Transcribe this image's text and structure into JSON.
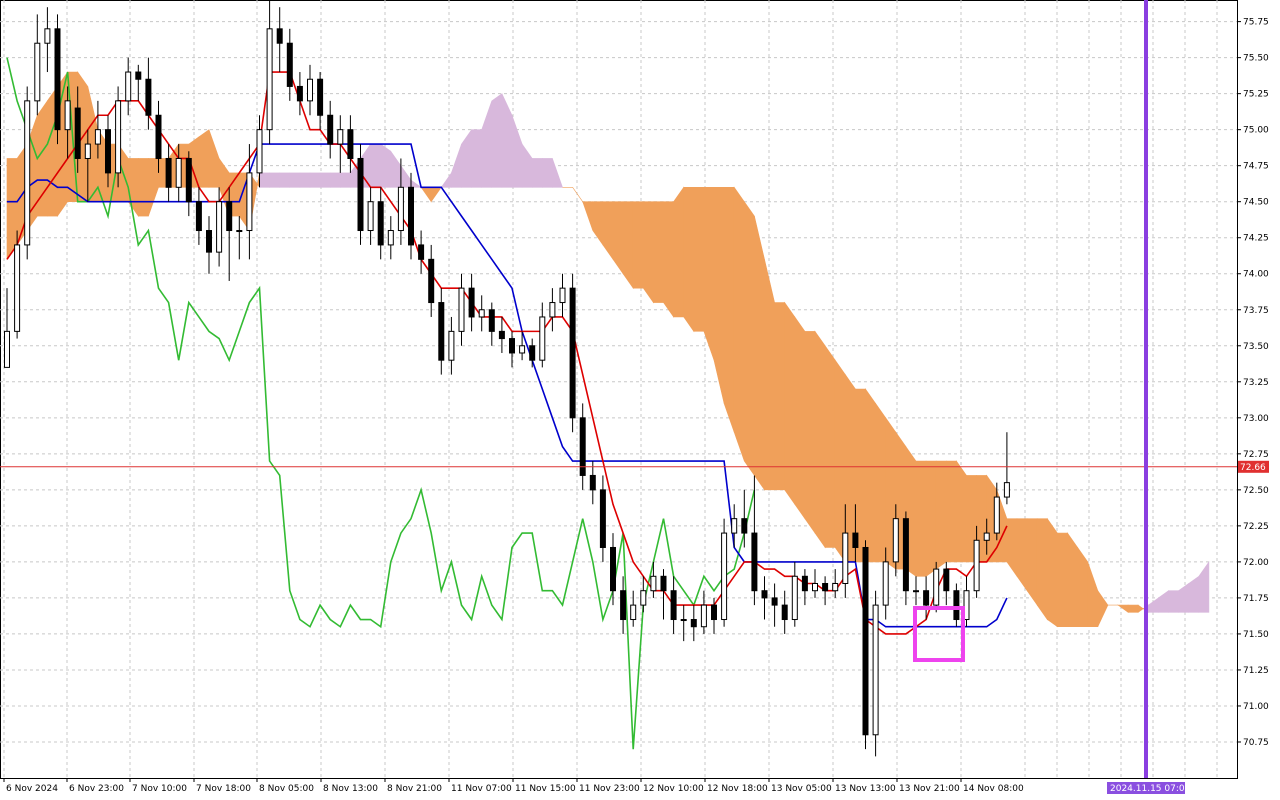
{
  "chart_data": {
    "type": "candlestick",
    "title": "",
    "xlabel": "",
    "ylabel": "",
    "ylim": [
      70.5,
      75.9
    ],
    "grid": true,
    "y_ticks": [
      "75.75",
      "75.50",
      "75.25",
      "75.00",
      "74.75",
      "74.50",
      "74.25",
      "74.00",
      "73.75",
      "73.50",
      "73.25",
      "73.00",
      "72.75",
      "72.50",
      "72.25",
      "72.00",
      "71.75",
      "71.50",
      "71.25",
      "71.00",
      "70.75"
    ],
    "x_ticks": [
      "6 Nov 2024",
      "6 Nov 23:00",
      "7 Nov 10:00",
      "7 Nov 18:00",
      "8 Nov 05:00",
      "8 Nov 13:00",
      "8 Nov 21:00",
      "11 Nov 07:00",
      "11 Nov 15:00",
      "11 Nov 23:00",
      "12 Nov 10:00",
      "12 Nov 18:00",
      "13 Nov 05:00",
      "13 Nov 13:00",
      "13 Nov 21:00",
      "14 Nov 08:00"
    ],
    "current_price": "72.66",
    "future_marker_label": "2024.11.15 07:00",
    "colors": {
      "bull": "#ffffff",
      "bear": "#000000",
      "tenkan": "#dd0000",
      "kijun": "#0000cc",
      "chikou": "#33bb33",
      "kumo_bull": "#f0a05a",
      "kumo_bear": "#d8b8dc",
      "price_line": "#dd3333",
      "future_line": "#8a3ee0",
      "highlight": "#ee44ee"
    },
    "candles": [
      [
        73.6,
        73.35,
        73.9,
        73.45
      ],
      [
        74.2,
        73.6,
        74.3,
        73.55
      ],
      [
        75.2,
        74.2,
        75.3,
        74.1
      ],
      [
        75.6,
        75.2,
        75.8,
        75.1
      ],
      [
        75.7,
        75.6,
        75.85,
        75.4
      ],
      [
        75.0,
        75.7,
        75.8,
        74.9
      ],
      [
        75.2,
        75.0,
        75.3,
        74.8
      ],
      [
        74.8,
        75.15,
        75.3,
        74.7
      ],
      [
        74.9,
        74.8,
        75.0,
        74.5
      ],
      [
        75.0,
        74.9,
        75.2,
        74.8
      ],
      [
        74.7,
        75.0,
        75.1,
        74.6
      ],
      [
        75.2,
        74.7,
        75.3,
        74.6
      ],
      [
        75.4,
        75.2,
        75.5,
        75.1
      ],
      [
        75.35,
        75.4,
        75.45,
        75.2
      ],
      [
        75.1,
        75.35,
        75.5,
        75.0
      ],
      [
        74.8,
        75.1,
        75.2,
        74.7
      ],
      [
        74.6,
        74.8,
        74.9,
        74.5
      ],
      [
        74.8,
        74.6,
        74.9,
        74.5
      ],
      [
        74.5,
        74.8,
        74.85,
        74.4
      ],
      [
        74.3,
        74.5,
        74.6,
        74.2
      ],
      [
        74.15,
        74.3,
        74.4,
        74.0
      ],
      [
        74.5,
        74.15,
        74.6,
        74.05
      ],
      [
        74.3,
        74.5,
        74.6,
        73.95
      ],
      [
        74.3,
        74.3,
        74.4,
        74.1
      ],
      [
        74.7,
        74.3,
        74.9,
        74.1
      ],
      [
        75.0,
        74.7,
        75.1,
        74.6
      ],
      [
        75.7,
        75.0,
        75.9,
        74.9
      ],
      [
        75.6,
        75.7,
        75.85,
        75.4
      ],
      [
        75.3,
        75.6,
        75.7,
        75.2
      ],
      [
        75.2,
        75.3,
        75.4,
        75.1
      ],
      [
        75.35,
        75.2,
        75.45,
        75.1
      ],
      [
        75.1,
        75.35,
        75.4,
        75.0
      ],
      [
        74.9,
        75.1,
        75.2,
        74.8
      ],
      [
        75.0,
        74.9,
        75.1,
        74.7
      ],
      [
        74.8,
        75.0,
        75.1,
        74.7
      ],
      [
        74.3,
        74.8,
        74.9,
        74.2
      ],
      [
        74.5,
        74.3,
        74.6,
        74.2
      ],
      [
        74.2,
        74.5,
        74.6,
        74.1
      ],
      [
        74.3,
        74.2,
        74.4,
        74.1
      ],
      [
        74.6,
        74.3,
        74.8,
        74.2
      ],
      [
        74.2,
        74.6,
        74.7,
        74.1
      ],
      [
        74.1,
        74.2,
        74.3,
        74.0
      ],
      [
        73.8,
        74.1,
        74.2,
        73.7
      ],
      [
        73.4,
        73.8,
        73.9,
        73.3
      ],
      [
        73.6,
        73.4,
        73.7,
        73.3
      ],
      [
        73.9,
        73.6,
        74.0,
        73.5
      ],
      [
        73.7,
        73.9,
        74.0,
        73.6
      ],
      [
        73.75,
        73.7,
        73.85,
        73.6
      ],
      [
        73.6,
        73.75,
        73.8,
        73.5
      ],
      [
        73.55,
        73.6,
        73.7,
        73.45
      ],
      [
        73.45,
        73.55,
        73.6,
        73.35
      ],
      [
        73.5,
        73.45,
        73.6,
        73.4
      ],
      [
        73.4,
        73.5,
        73.55,
        73.35
      ],
      [
        73.7,
        73.4,
        73.8,
        73.35
      ],
      [
        73.8,
        73.7,
        73.9,
        73.6
      ],
      [
        73.9,
        73.8,
        74.0,
        73.7
      ],
      [
        73.0,
        73.9,
        74.0,
        72.9
      ],
      [
        72.6,
        73.0,
        73.1,
        72.5
      ],
      [
        72.5,
        72.6,
        72.7,
        72.4
      ],
      [
        72.1,
        72.5,
        72.6,
        72.0
      ],
      [
        71.8,
        72.1,
        72.2,
        71.7
      ],
      [
        71.6,
        71.8,
        71.9,
        71.5
      ],
      [
        71.7,
        71.6,
        71.8,
        71.55
      ],
      [
        71.8,
        71.7,
        71.9,
        71.65
      ],
      [
        71.9,
        71.8,
        72.0,
        71.75
      ],
      [
        71.8,
        71.9,
        71.95,
        71.6
      ],
      [
        71.6,
        71.8,
        71.9,
        71.5
      ],
      [
        71.6,
        71.6,
        71.7,
        71.45
      ],
      [
        71.55,
        71.6,
        71.7,
        71.45
      ],
      [
        71.7,
        71.55,
        71.8,
        71.5
      ],
      [
        71.6,
        71.7,
        71.75,
        71.5
      ],
      [
        72.2,
        71.6,
        72.3,
        71.55
      ],
      [
        72.3,
        72.2,
        72.4,
        72.1
      ],
      [
        72.2,
        72.3,
        72.5,
        72.1
      ],
      [
        71.8,
        72.2,
        72.6,
        71.7
      ],
      [
        71.75,
        71.8,
        71.9,
        71.6
      ],
      [
        71.7,
        71.75,
        71.85,
        71.55
      ],
      [
        71.6,
        71.7,
        71.8,
        71.5
      ],
      [
        71.9,
        71.6,
        72.0,
        71.55
      ],
      [
        71.8,
        71.9,
        71.95,
        71.7
      ],
      [
        71.85,
        71.8,
        71.95,
        71.75
      ],
      [
        71.8,
        71.85,
        71.9,
        71.7
      ],
      [
        71.85,
        71.8,
        71.95,
        71.75
      ],
      [
        72.2,
        71.85,
        72.4,
        71.75
      ],
      [
        72.1,
        72.2,
        72.4,
        72.0
      ],
      [
        70.8,
        72.1,
        72.15,
        70.7
      ],
      [
        71.7,
        70.8,
        71.8,
        70.65
      ],
      [
        72.0,
        71.7,
        72.1,
        71.6
      ],
      [
        72.3,
        72.0,
        72.4,
        71.9
      ],
      [
        71.8,
        72.3,
        72.35,
        71.7
      ],
      [
        71.8,
        71.8,
        71.9,
        71.7
      ],
      [
        71.7,
        71.8,
        71.9,
        71.6
      ],
      [
        71.95,
        71.7,
        72.0,
        71.65
      ],
      [
        71.8,
        71.95,
        72.0,
        71.7
      ],
      [
        71.6,
        71.8,
        71.85,
        71.55
      ],
      [
        71.8,
        71.6,
        71.9,
        71.55
      ],
      [
        72.15,
        71.8,
        72.25,
        71.75
      ],
      [
        72.2,
        72.15,
        72.3,
        72.05
      ],
      [
        72.45,
        72.2,
        72.55,
        72.15
      ],
      [
        72.55,
        72.45,
        72.9,
        72.4
      ]
    ],
    "tenkan": [
      74.1,
      74.2,
      74.4,
      74.5,
      74.6,
      74.7,
      74.8,
      74.9,
      75.0,
      75.1,
      75.1,
      75.2,
      75.2,
      75.2,
      75.1,
      75.0,
      74.9,
      74.8,
      74.8,
      74.6,
      74.5,
      74.5,
      74.6,
      74.7,
      74.8,
      74.9,
      75.4,
      75.4,
      75.4,
      75.2,
      75.0,
      75.0,
      74.9,
      74.9,
      74.8,
      74.7,
      74.6,
      74.6,
      74.5,
      74.4,
      74.3,
      74.1,
      74.0,
      73.9,
      73.9,
      73.9,
      73.8,
      73.7,
      73.7,
      73.7,
      73.6,
      73.6,
      73.6,
      73.6,
      73.7,
      73.7,
      73.6,
      73.3,
      73.0,
      72.7,
      72.4,
      72.2,
      72.0,
      71.9,
      71.8,
      71.8,
      71.7,
      71.7,
      71.7,
      71.7,
      71.7,
      71.8,
      71.9,
      72.0,
      72.0,
      71.95,
      71.95,
      71.9,
      71.9,
      71.85,
      71.85,
      71.8,
      71.8,
      71.9,
      71.95,
      71.6,
      71.55,
      71.5,
      71.5,
      71.5,
      71.55,
      71.6,
      71.8,
      71.95,
      71.95,
      71.9,
      72.0,
      72.0,
      72.1,
      72.25
    ],
    "kijun": [
      74.5,
      74.5,
      74.6,
      74.65,
      74.65,
      74.6,
      74.6,
      74.55,
      74.5,
      74.5,
      74.5,
      74.5,
      74.5,
      74.5,
      74.5,
      74.5,
      74.5,
      74.5,
      74.5,
      74.5,
      74.5,
      74.5,
      74.5,
      74.5,
      74.7,
      74.9,
      74.9,
      74.9,
      74.9,
      74.9,
      74.9,
      74.9,
      74.9,
      74.9,
      74.9,
      74.9,
      74.9,
      74.9,
      74.9,
      74.9,
      74.9,
      74.6,
      74.6,
      74.6,
      74.5,
      74.4,
      74.3,
      74.2,
      74.1,
      74.0,
      73.9,
      73.6,
      73.4,
      73.2,
      73.0,
      72.8,
      72.7,
      72.7,
      72.7,
      72.7,
      72.7,
      72.7,
      72.7,
      72.7,
      72.7,
      72.7,
      72.7,
      72.7,
      72.7,
      72.7,
      72.7,
      72.7,
      72.1,
      72.0,
      72.0,
      72.0,
      72.0,
      72.0,
      72.0,
      72.0,
      72.0,
      72.0,
      72.0,
      72.0,
      72.0,
      71.6,
      71.6,
      71.55,
      71.55,
      71.55,
      71.55,
      71.55,
      71.55,
      71.55,
      71.55,
      71.55,
      71.55,
      71.55,
      71.6,
      71.75
    ],
    "chikou": [
      75.5,
      75.2,
      75.0,
      74.8,
      74.9,
      75.1,
      75.4,
      74.5,
      74.5,
      74.6,
      74.4,
      74.8,
      74.6,
      74.2,
      74.3,
      73.9,
      73.8,
      73.4,
      73.8,
      73.7,
      73.6,
      73.55,
      73.4,
      73.6,
      73.8,
      73.9,
      72.7,
      72.6,
      71.8,
      71.6,
      71.55,
      71.7,
      71.6,
      71.55,
      71.7,
      71.6,
      71.6,
      71.55,
      72.0,
      72.2,
      72.3,
      72.5,
      72.2,
      71.8,
      72.0,
      71.7,
      71.6,
      71.9,
      71.7,
      71.6,
      72.1,
      72.2,
      72.2,
      71.8,
      71.8,
      71.7,
      72.0,
      72.3,
      72.0,
      71.6,
      71.8,
      72.2,
      70.7,
      71.7,
      72.0,
      72.3,
      71.9,
      71.8,
      71.7,
      71.9,
      71.8,
      71.9,
      71.95,
      72.2,
      72.5
    ],
    "kumo": [
      [
        74.8,
        74.1
      ],
      [
        74.8,
        74.2
      ],
      [
        74.9,
        74.3
      ],
      [
        75.1,
        74.4
      ],
      [
        75.2,
        74.4
      ],
      [
        75.3,
        74.4
      ],
      [
        75.4,
        74.5
      ],
      [
        75.4,
        74.5
      ],
      [
        75.3,
        74.5
      ],
      [
        75.0,
        74.5
      ],
      [
        74.9,
        74.5
      ],
      [
        74.9,
        74.5
      ],
      [
        74.8,
        74.5
      ],
      [
        74.8,
        74.4
      ],
      [
        74.8,
        74.4
      ],
      [
        74.8,
        74.6
      ],
      [
        74.8,
        74.6
      ],
      [
        74.9,
        74.6
      ],
      [
        74.9,
        74.6
      ],
      [
        74.95,
        74.6
      ],
      [
        75.0,
        74.6
      ],
      [
        74.8,
        74.6
      ],
      [
        74.7,
        74.4
      ],
      [
        74.7,
        74.4
      ],
      [
        74.7,
        74.3
      ],
      [
        74.6,
        74.7
      ],
      [
        74.6,
        74.7
      ],
      [
        74.6,
        74.7
      ],
      [
        74.6,
        74.7
      ],
      [
        74.6,
        74.7
      ],
      [
        74.6,
        74.7
      ],
      [
        74.6,
        74.7
      ],
      [
        74.6,
        74.7
      ],
      [
        74.6,
        74.7
      ],
      [
        74.6,
        74.7
      ],
      [
        74.6,
        74.8
      ],
      [
        74.6,
        74.9
      ],
      [
        74.6,
        74.9
      ],
      [
        74.6,
        74.85
      ],
      [
        74.6,
        74.75
      ],
      [
        74.6,
        74.65
      ],
      [
        74.6,
        74.6
      ],
      [
        74.6,
        74.5
      ],
      [
        74.6,
        74.6
      ],
      [
        74.6,
        74.7
      ],
      [
        74.6,
        74.9
      ],
      [
        74.6,
        75.0
      ],
      [
        74.6,
        75.0
      ],
      [
        74.6,
        75.2
      ],
      [
        74.6,
        75.25
      ],
      [
        74.6,
        75.1
      ],
      [
        74.6,
        74.9
      ],
      [
        74.6,
        74.8
      ],
      [
        74.6,
        74.8
      ],
      [
        74.6,
        74.8
      ],
      [
        74.6,
        74.6
      ],
      [
        74.6,
        74.6
      ],
      [
        74.5,
        74.5
      ],
      [
        74.5,
        74.3
      ],
      [
        74.5,
        74.2
      ],
      [
        74.5,
        74.1
      ],
      [
        74.5,
        74.0
      ],
      [
        74.5,
        73.9
      ],
      [
        74.5,
        73.9
      ],
      [
        74.5,
        73.8
      ],
      [
        74.5,
        73.8
      ],
      [
        74.5,
        73.7
      ],
      [
        74.6,
        73.7
      ],
      [
        74.6,
        73.6
      ],
      [
        74.6,
        73.6
      ],
      [
        74.6,
        73.4
      ],
      [
        74.6,
        73.1
      ],
      [
        74.6,
        72.9
      ],
      [
        74.5,
        72.7
      ],
      [
        74.4,
        72.6
      ],
      [
        74.1,
        72.5
      ],
      [
        73.8,
        72.5
      ],
      [
        73.8,
        72.5
      ],
      [
        73.7,
        72.4
      ],
      [
        73.6,
        72.3
      ],
      [
        73.6,
        72.2
      ],
      [
        73.5,
        72.1
      ],
      [
        73.4,
        72.1
      ],
      [
        73.3,
        72.0
      ],
      [
        73.2,
        72.0
      ],
      [
        73.2,
        72.0
      ],
      [
        73.1,
        72.0
      ],
      [
        73.0,
        72.0
      ],
      [
        72.9,
        71.95
      ],
      [
        72.8,
        71.95
      ],
      [
        72.7,
        71.9
      ],
      [
        72.7,
        71.9
      ],
      [
        72.7,
        71.95
      ],
      [
        72.7,
        72.0
      ],
      [
        72.7,
        72.0
      ],
      [
        72.6,
        72.0
      ],
      [
        72.6,
        72.0
      ],
      [
        72.6,
        72.0
      ],
      [
        72.5,
        72.0
      ],
      [
        72.3,
        72.0
      ],
      [
        72.3,
        71.9
      ],
      [
        72.3,
        71.8
      ],
      [
        72.3,
        71.7
      ],
      [
        72.3,
        71.6
      ],
      [
        72.2,
        71.55
      ],
      [
        72.2,
        71.55
      ],
      [
        72.1,
        71.55
      ],
      [
        72.0,
        71.55
      ],
      [
        71.8,
        71.55
      ],
      [
        71.7,
        71.7
      ],
      [
        71.7,
        71.7
      ],
      [
        71.7,
        71.65
      ],
      [
        71.7,
        71.65
      ],
      [
        71.65,
        71.7
      ],
      [
        71.65,
        71.75
      ],
      [
        71.65,
        71.8
      ],
      [
        71.65,
        71.8
      ],
      [
        71.65,
        71.85
      ],
      [
        71.65,
        71.9
      ],
      [
        71.65,
        72.0
      ]
    ]
  }
}
